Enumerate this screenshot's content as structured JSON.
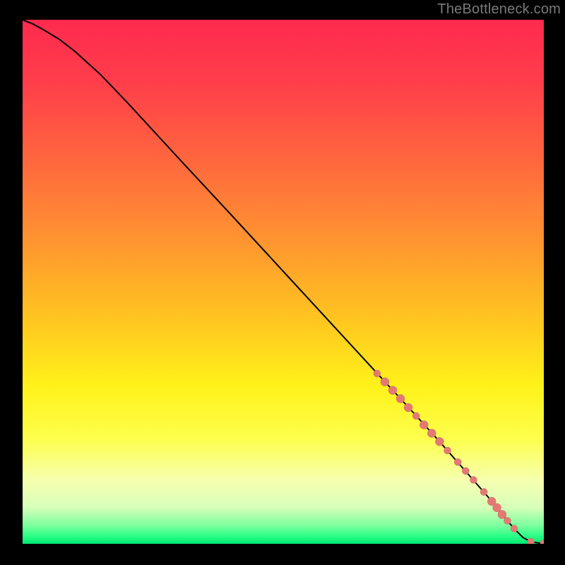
{
  "attribution": "TheBottleneck.com",
  "colors": {
    "page_bg": "#000000",
    "attribution_text": "#7a7a7a",
    "curve_stroke": "#000000",
    "marker_fill": "#e27a73",
    "marker_stroke": "#d66a63",
    "gradient_stops": [
      {
        "offset": 0.0,
        "color": "#ff2a4f"
      },
      {
        "offset": 0.12,
        "color": "#ff3e4a"
      },
      {
        "offset": 0.28,
        "color": "#ff6a3d"
      },
      {
        "offset": 0.44,
        "color": "#ff9a2e"
      },
      {
        "offset": 0.58,
        "color": "#ffc81f"
      },
      {
        "offset": 0.7,
        "color": "#fff21a"
      },
      {
        "offset": 0.8,
        "color": "#fdff4d"
      },
      {
        "offset": 0.88,
        "color": "#f6ffb0"
      },
      {
        "offset": 0.93,
        "color": "#d8ffba"
      },
      {
        "offset": 0.965,
        "color": "#7dff9e"
      },
      {
        "offset": 0.985,
        "color": "#2bff86"
      },
      {
        "offset": 1.0,
        "color": "#00e772"
      }
    ]
  },
  "chart_data": {
    "type": "line",
    "title": "",
    "xlabel": "",
    "ylabel": "",
    "x_range": [
      0,
      100
    ],
    "y_range": [
      0,
      100
    ],
    "series": [
      {
        "name": "curve",
        "x": [
          0,
          2,
          4,
          7,
          10,
          15,
          20,
          30,
          40,
          50,
          60,
          70,
          75,
          80,
          83,
          86,
          89,
          91,
          93,
          94.5,
          96,
          97.5,
          99,
          100
        ],
        "y": [
          100,
          99.2,
          98.1,
          96.3,
          94.0,
          89.5,
          84.3,
          73.5,
          62.8,
          52.0,
          41.2,
          30.4,
          25.0,
          19.5,
          16.1,
          12.7,
          9.3,
          6.9,
          4.4,
          2.7,
          1.2,
          0.4,
          0.15,
          0.15
        ]
      }
    ],
    "markers": [
      {
        "x": 68.0,
        "y": 32.5,
        "r": 5
      },
      {
        "x": 69.5,
        "y": 30.9,
        "r": 6
      },
      {
        "x": 71.0,
        "y": 29.3,
        "r": 6
      },
      {
        "x": 72.5,
        "y": 27.7,
        "r": 6
      },
      {
        "x": 74.0,
        "y": 26.0,
        "r": 6
      },
      {
        "x": 75.5,
        "y": 24.4,
        "r": 5
      },
      {
        "x": 77.0,
        "y": 22.7,
        "r": 6
      },
      {
        "x": 78.5,
        "y": 21.1,
        "r": 6
      },
      {
        "x": 80.0,
        "y": 19.5,
        "r": 6
      },
      {
        "x": 81.5,
        "y": 17.8,
        "r": 5
      },
      {
        "x": 83.5,
        "y": 15.6,
        "r": 5
      },
      {
        "x": 85.0,
        "y": 13.9,
        "r": 5
      },
      {
        "x": 86.5,
        "y": 12.2,
        "r": 5
      },
      {
        "x": 88.5,
        "y": 9.9,
        "r": 5
      },
      {
        "x": 90.0,
        "y": 8.1,
        "r": 6
      },
      {
        "x": 91.0,
        "y": 6.9,
        "r": 6
      },
      {
        "x": 92.0,
        "y": 5.6,
        "r": 6
      },
      {
        "x": 93.0,
        "y": 4.4,
        "r": 5
      },
      {
        "x": 94.3,
        "y": 2.9,
        "r": 5
      },
      {
        "x": 97.5,
        "y": 0.4,
        "r": 5
      },
      {
        "x": 100.0,
        "y": 0.15,
        "r": 5
      }
    ]
  }
}
